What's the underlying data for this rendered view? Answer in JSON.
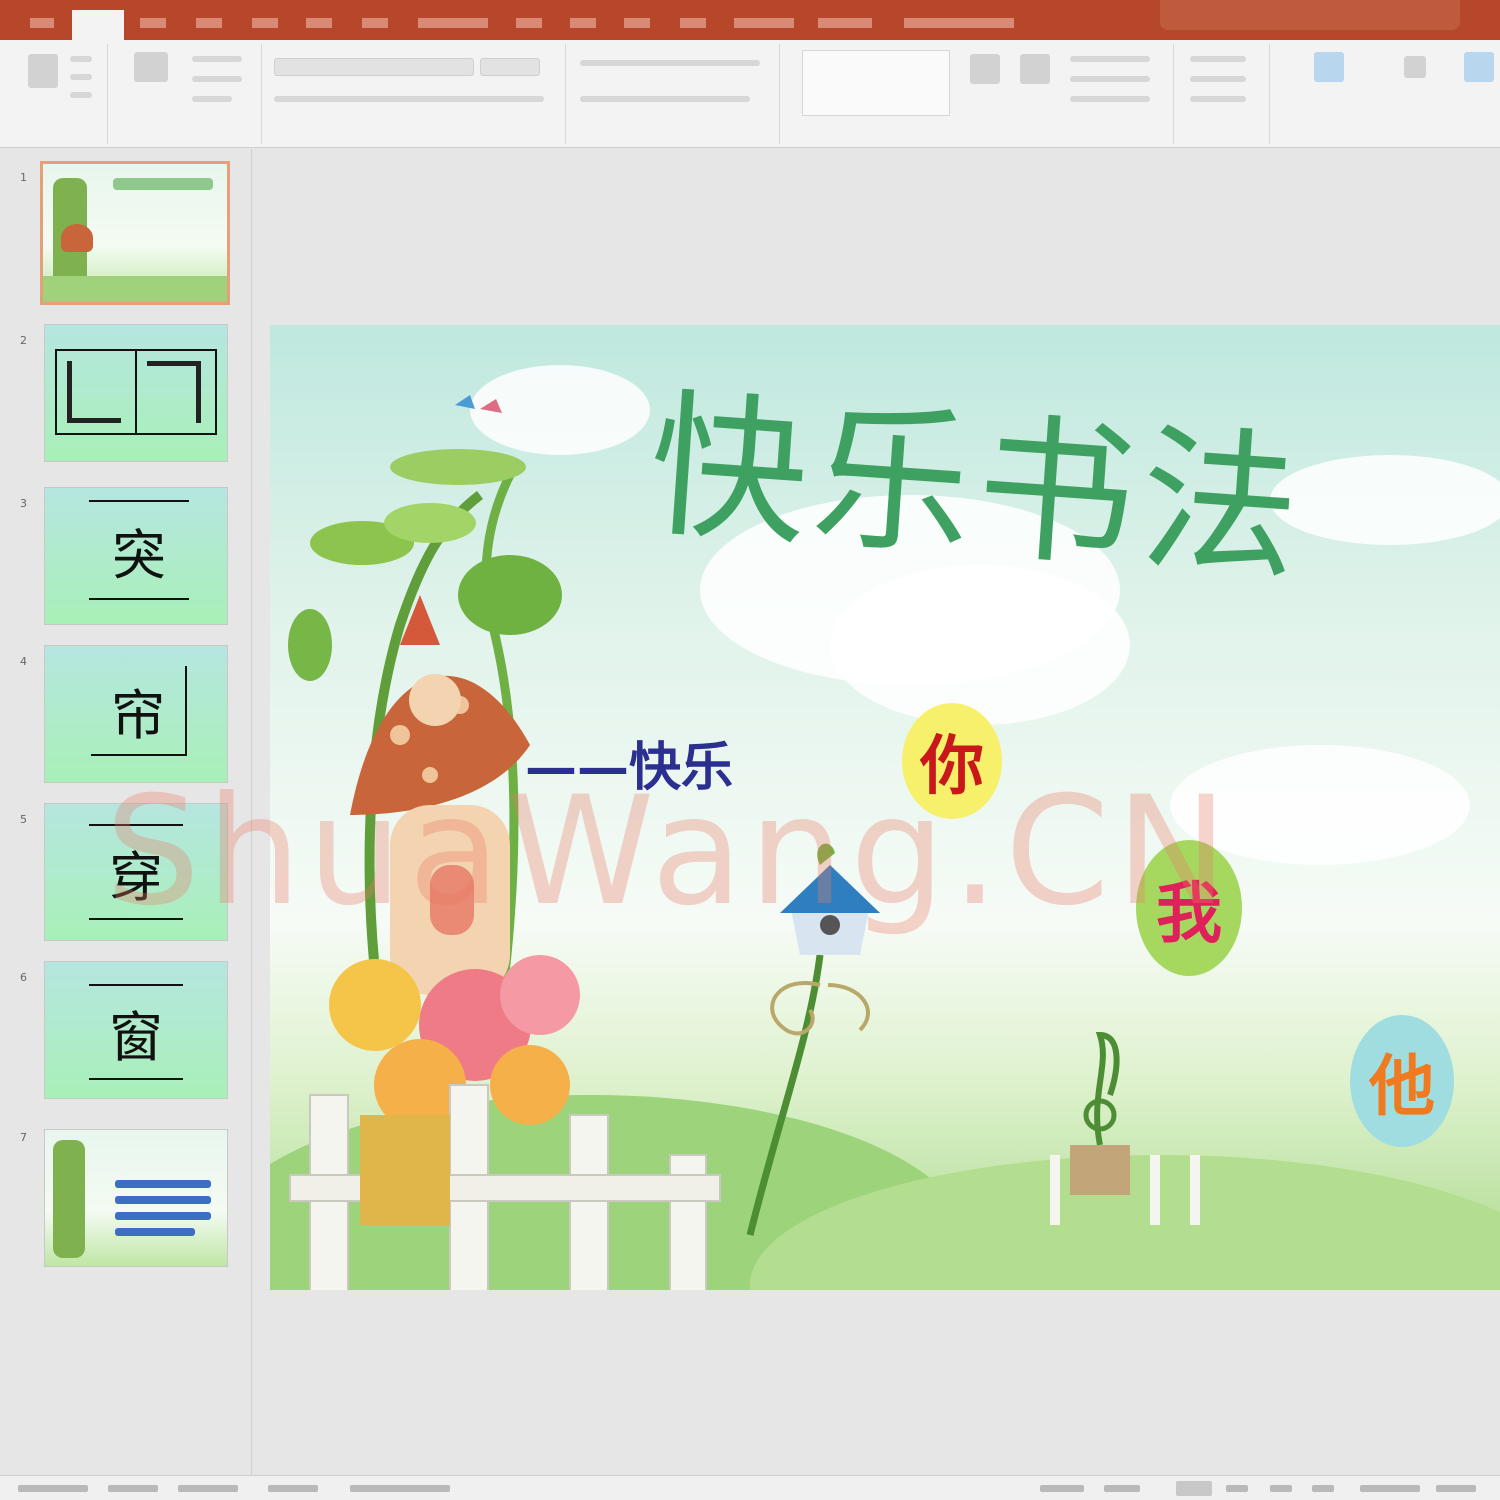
{
  "ribbon": {
    "group_labels": [
      "",
      "",
      "",
      "",
      "",
      "",
      ""
    ]
  },
  "thumbnails": [
    {
      "num": "1",
      "char": ""
    },
    {
      "num": "2",
      "char": ""
    },
    {
      "num": "3",
      "char": "突"
    },
    {
      "num": "4",
      "char": "帘"
    },
    {
      "num": "5",
      "char": "穿"
    },
    {
      "num": "6",
      "char": "窗"
    },
    {
      "num": "7",
      "char": ""
    }
  ],
  "slide": {
    "title": "快乐书法",
    "subtitle": "——快乐",
    "bubbles": [
      {
        "text": "你",
        "bg": "#f7f06a",
        "color": "#c8181c"
      },
      {
        "text": "我",
        "bg": "#a6d860",
        "color": "#e0205a"
      },
      {
        "text": "他",
        "bg": "#9fdde0",
        "color": "#f07a20"
      }
    ],
    "watermark": "ShuaWang.CN"
  },
  "colors": {
    "accent": "#b7472a",
    "title_green": "#3fa161",
    "subtitle_blue": "#2b2f8f"
  }
}
